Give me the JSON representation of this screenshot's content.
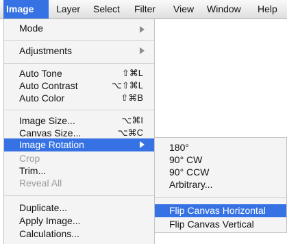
{
  "menubar": {
    "items": [
      {
        "label": "Image"
      },
      {
        "label": "Layer"
      },
      {
        "label": "Select"
      },
      {
        "label": "Filter"
      },
      {
        "label": "View"
      },
      {
        "label": "Window"
      },
      {
        "label": "Help"
      }
    ],
    "active": "Image"
  },
  "image_menu": {
    "items": [
      {
        "label": "Mode",
        "has_submenu": true
      },
      {
        "label": "Adjustments",
        "has_submenu": true
      },
      {
        "label": "Auto Tone",
        "shortcut": "⇧⌘L"
      },
      {
        "label": "Auto Contrast",
        "shortcut": "⌥⇧⌘L"
      },
      {
        "label": "Auto Color",
        "shortcut": "⇧⌘B"
      },
      {
        "label": "Image Size...",
        "shortcut": "⌥⌘I"
      },
      {
        "label": "Canvas Size...",
        "shortcut": "⌥⌘C"
      },
      {
        "label": "Image Rotation",
        "has_submenu": true,
        "highlighted": true
      },
      {
        "label": "Crop",
        "disabled": true
      },
      {
        "label": "Trim..."
      },
      {
        "label": "Reveal All",
        "disabled": true
      },
      {
        "label": "Duplicate..."
      },
      {
        "label": "Apply Image..."
      },
      {
        "label": "Calculations..."
      }
    ]
  },
  "rotation_submenu": {
    "items": [
      {
        "label": "180°"
      },
      {
        "label": "90° CW"
      },
      {
        "label": "90° CCW"
      },
      {
        "label": "Arbitrary..."
      },
      {
        "label": "Flip Canvas Horizontal",
        "highlighted": true
      },
      {
        "label": "Flip Canvas Vertical"
      }
    ]
  },
  "colors": {
    "highlight": "#3672e3",
    "menu_background": "#f4f4f4",
    "disabled_text": "#9a9a9a"
  }
}
